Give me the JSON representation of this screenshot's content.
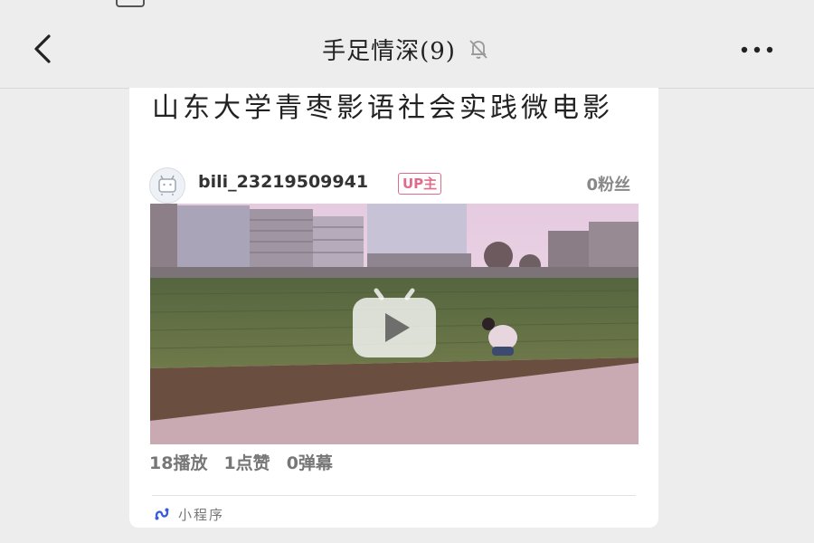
{
  "header": {
    "chat_title": "手足情深(9)",
    "icons": {
      "back": "chevron-left-icon",
      "mute": "bell-off-icon",
      "more": "more-horizontal-icon"
    }
  },
  "card": {
    "title": "山东大学青枣影语社会实践微电影",
    "author": "bili_23219509941",
    "badge": "UP主",
    "fans": "0粉丝",
    "stats": {
      "plays": "18播放",
      "likes": "1点赞",
      "danmaku": "0弹幕"
    },
    "source_label": "小程序",
    "icons": {
      "avatar": "bilibili-tv-avatar",
      "play": "bilibili-play-icon",
      "source": "mini-program-icon"
    }
  },
  "colors": {
    "badge": "#e06b8b",
    "background": "#ededed",
    "card": "#ffffff"
  }
}
